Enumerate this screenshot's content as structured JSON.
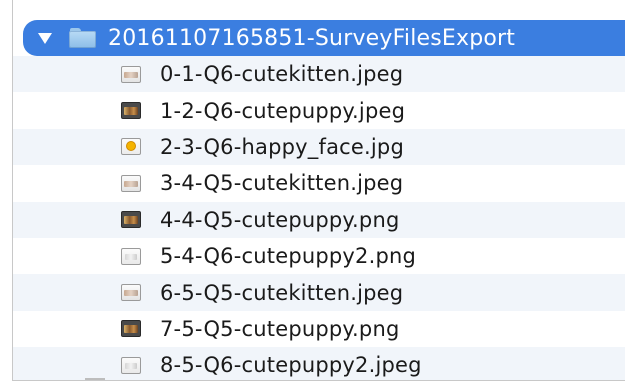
{
  "folder": {
    "name": "20161107165851-SurveyFilesExport",
    "expanded": true
  },
  "files": [
    {
      "name": "0-1-Q6-cutekitten.jpeg",
      "icon": "kitten-thumbnail-icon",
      "style": "light"
    },
    {
      "name": "1-2-Q6-cutepuppy.jpeg",
      "icon": "puppy-thumbnail-icon",
      "style": "dark"
    },
    {
      "name": "2-3-Q6-happy_face.jpg",
      "icon": "happy-face-thumbnail-icon",
      "style": "face"
    },
    {
      "name": "3-4-Q5-cutekitten.jpeg",
      "icon": "kitten-thumbnail-icon",
      "style": "light"
    },
    {
      "name": "4-4-Q5-cutepuppy.png",
      "icon": "puppy-thumbnail-icon",
      "style": "dark"
    },
    {
      "name": "5-4-Q6-cutepuppy2.png",
      "icon": "puppy2-thumbnail-icon",
      "style": "pale"
    },
    {
      "name": "6-5-Q5-cutekitten.jpeg",
      "icon": "kitten-thumbnail-icon",
      "style": "light"
    },
    {
      "name": "7-5-Q5-cutepuppy.png",
      "icon": "puppy-thumbnail-icon",
      "style": "dark"
    },
    {
      "name": "8-5-Q6-cutepuppy2.jpeg",
      "icon": "puppy2-thumbnail-icon",
      "style": "pale"
    }
  ],
  "colors": {
    "selection": "#3b7ee0",
    "alternate_row": "#f1f5fa"
  }
}
